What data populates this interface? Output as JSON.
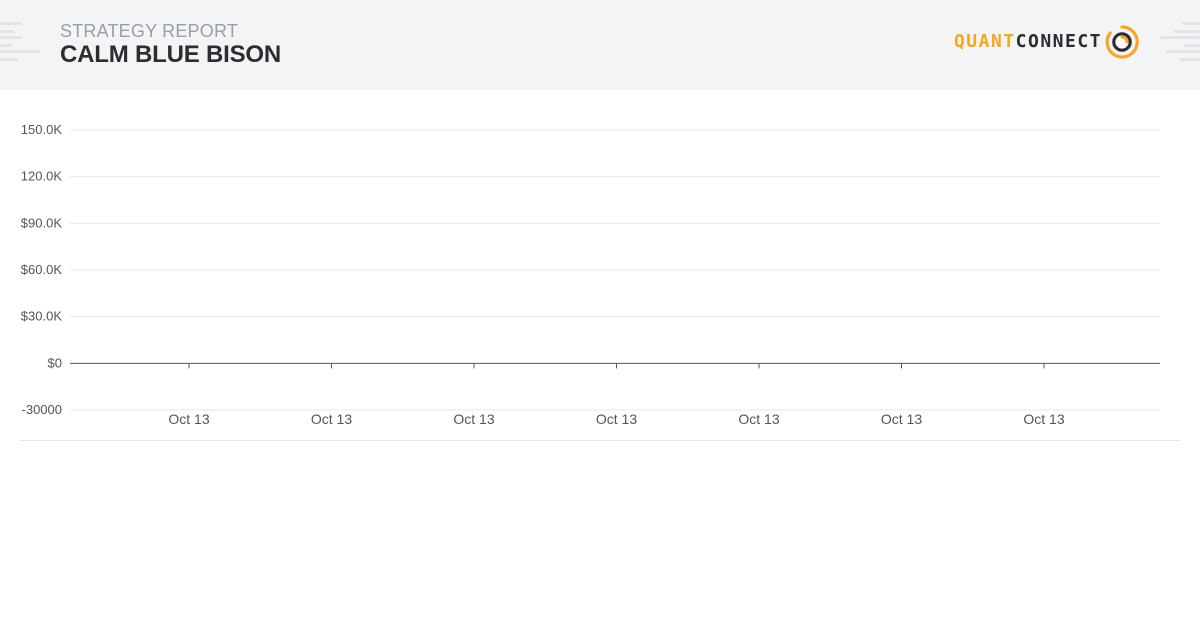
{
  "header": {
    "report_label": "STRATEGY REPORT",
    "strategy_name": "CALM BLUE BISON",
    "brand_part1": "QUANT",
    "brand_part2": "CONNECT",
    "brand_icon": "quantconnect-logo-icon"
  },
  "colors": {
    "header_bg": "#f3f4f6",
    "brand_orange": "#f5a623",
    "brand_dark": "#2b2d31",
    "gridline": "#e6e7ea",
    "zero_line": "#555555",
    "tick_text": "#555555"
  },
  "chart_data": {
    "type": "line",
    "title": "",
    "xlabel": "",
    "ylabel": "",
    "ylim": [
      -30000,
      150000
    ],
    "y_ticks": [
      150000,
      120000,
      90000,
      60000,
      30000,
      0,
      -30000
    ],
    "y_tick_labels": [
      "150.0K",
      "120.0K",
      "$90.0K",
      "$60.0K",
      "$30.0K",
      "$0",
      "-30000"
    ],
    "x_tick_labels": [
      "Oct 13",
      "Oct 13",
      "Oct 13",
      "Oct 13",
      "Oct 13",
      "Oct 13",
      "Oct 13"
    ],
    "grid": true,
    "legend": "none",
    "series": []
  }
}
